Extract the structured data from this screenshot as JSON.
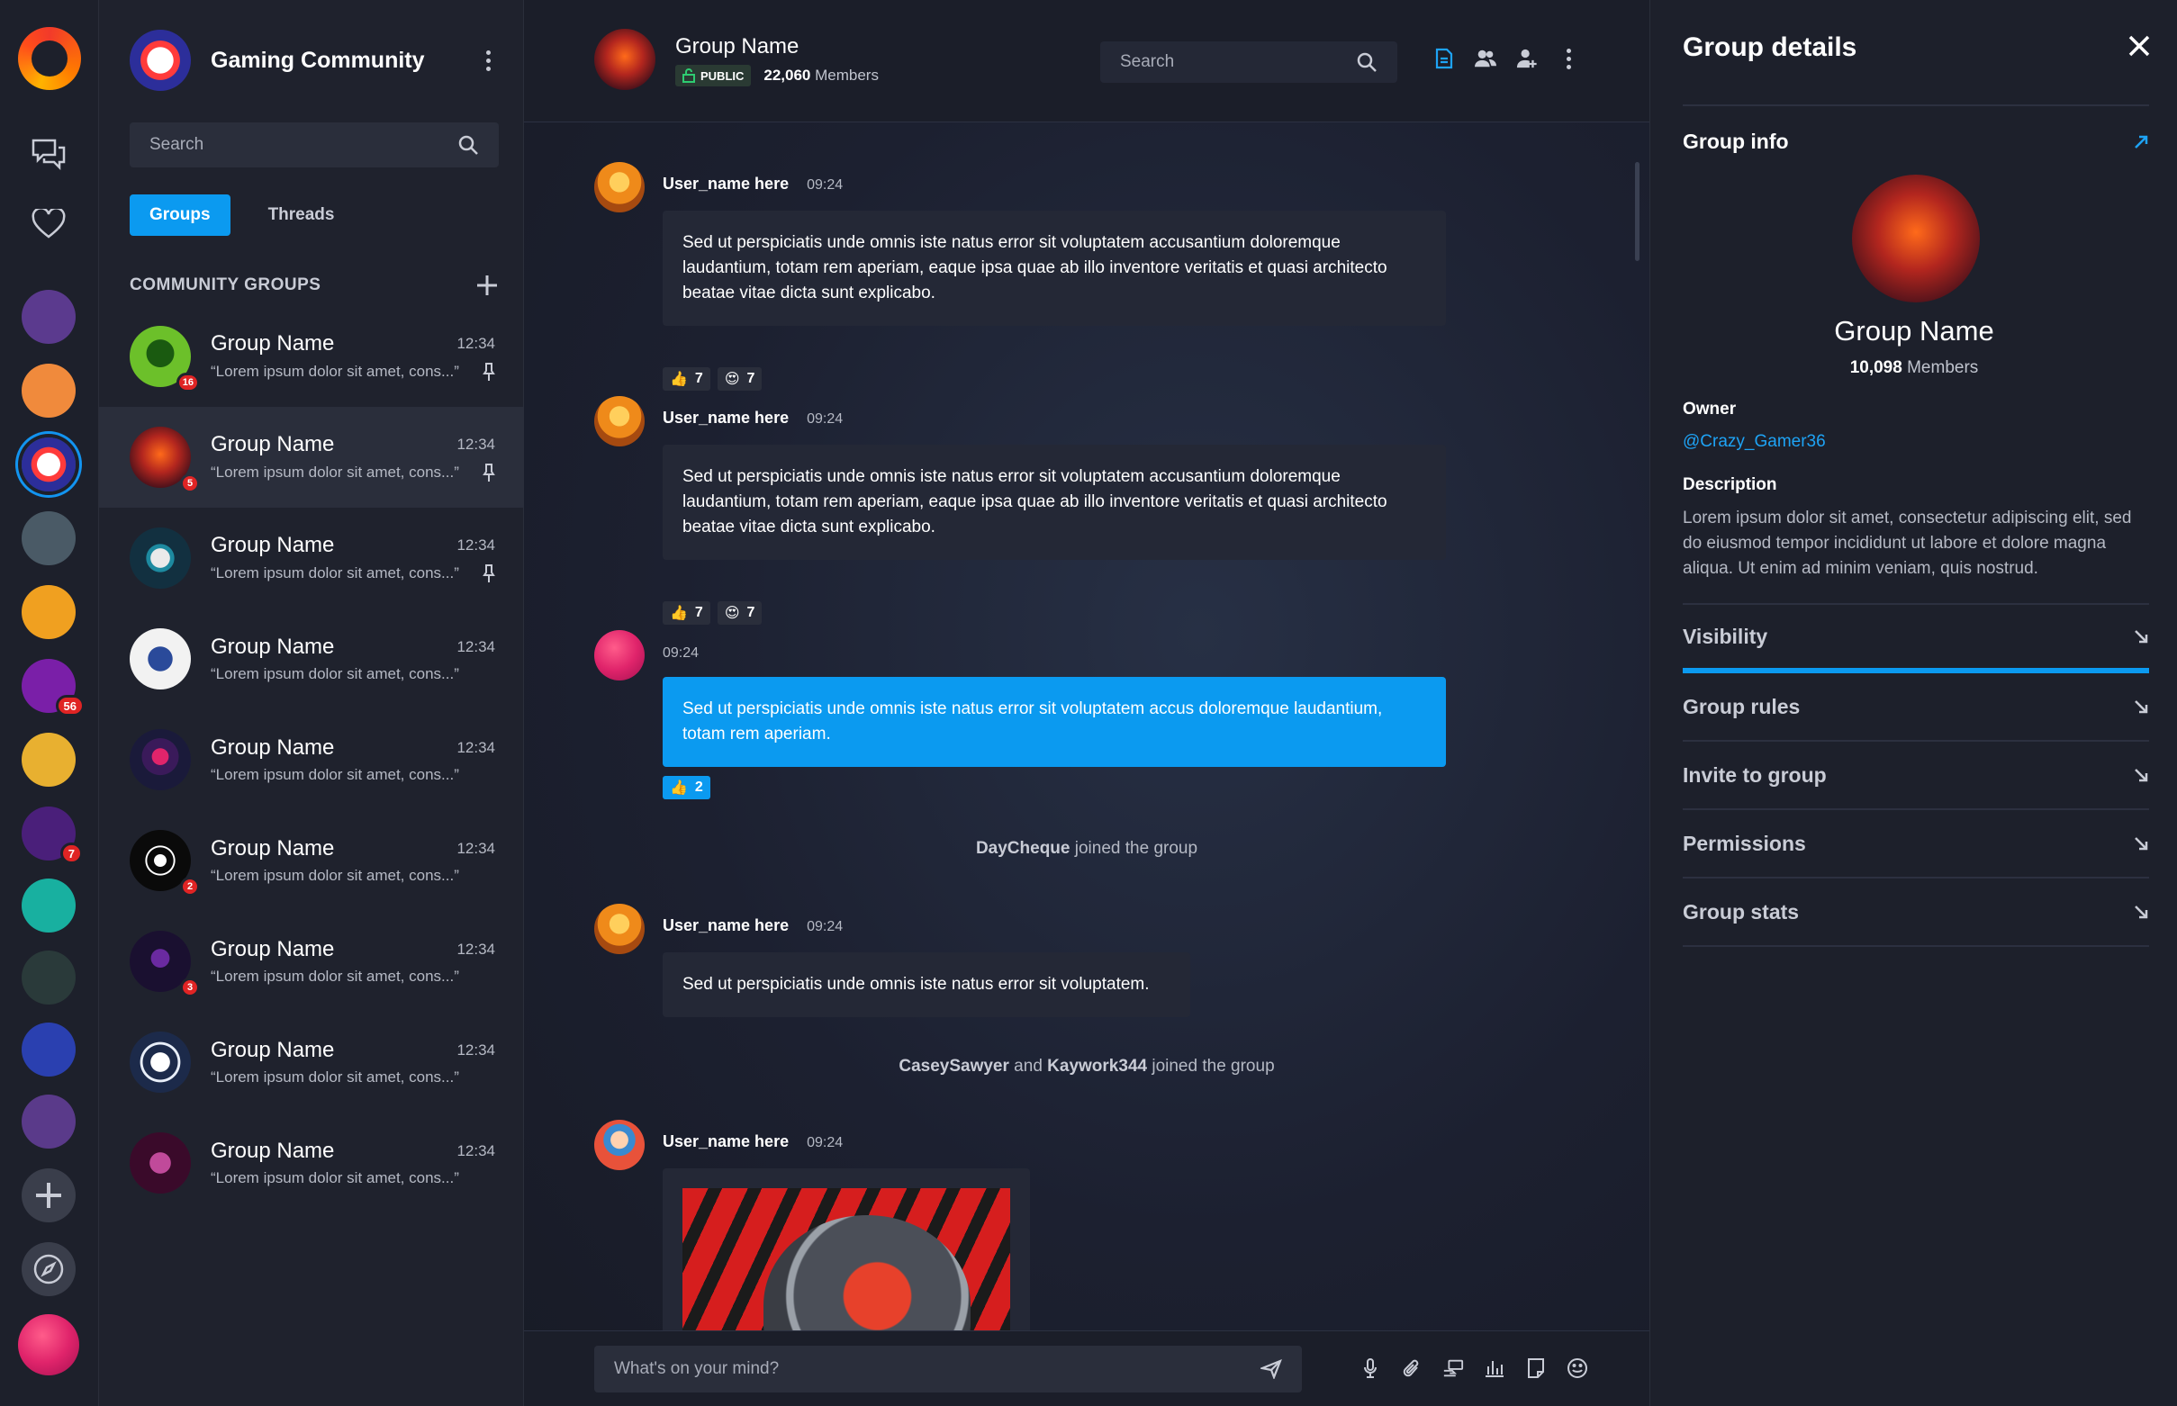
{
  "colors": {
    "accent": "#0b9af0",
    "background": "#171a24",
    "badge": "#e02424",
    "link": "#1ea3f5"
  },
  "rail": {
    "icons": [
      "logo",
      "chat-bubbles-icon",
      "heart-icon",
      "plus-icon",
      "compass-icon"
    ],
    "avatars": [
      {
        "name": "community-1",
        "color": "#5b3a8e"
      },
      {
        "name": "community-2",
        "color": "#f08a3c"
      },
      {
        "name": "community-3",
        "color": "#2c2e9a",
        "active": true
      },
      {
        "name": "community-4",
        "color": "#4a5a66"
      },
      {
        "name": "community-5",
        "color": "#f0a020"
      },
      {
        "name": "community-6",
        "color": "#7a1fa8",
        "badge": "56"
      },
      {
        "name": "community-7",
        "color": "#e8b030"
      },
      {
        "name": "community-8",
        "color": "#4a1f7a",
        "badge": "7"
      },
      {
        "name": "community-9",
        "color": "#18b0a0"
      },
      {
        "name": "community-10",
        "color": "#2a3a3a"
      },
      {
        "name": "community-11",
        "color": "#2a40b0"
      },
      {
        "name": "community-12",
        "color": "#5a3a8a"
      }
    ]
  },
  "panel": {
    "community_title": "Gaming Community",
    "search_placeholder": "Search",
    "tabs": [
      "Groups",
      "Threads"
    ],
    "section_label": "COMMUNITY GROUPS",
    "groups": [
      {
        "name": "Group Name",
        "time": "12:34",
        "preview": "“Lorem ipsum dolor sit amet, cons...”",
        "badge": "16",
        "pinned": true,
        "color": "#6cc02a"
      },
      {
        "name": "Group Name",
        "time": "12:34",
        "preview": "“Lorem ipsum dolor sit amet, cons...”",
        "badge": "5",
        "pinned": true,
        "color": "#b3261e",
        "active": true
      },
      {
        "name": "Group Name",
        "time": "12:34",
        "preview": "“Lorem ipsum dolor sit amet, cons...”",
        "badge": "",
        "pinned": true,
        "color": "#123040"
      },
      {
        "name": "Group Name",
        "time": "12:34",
        "preview": "“Lorem ipsum dolor sit amet, cons...”",
        "badge": "",
        "pinned": false,
        "color": "#f2f2f2"
      },
      {
        "name": "Group Name",
        "time": "12:34",
        "preview": "“Lorem ipsum dolor sit amet, cons...”",
        "badge": "",
        "pinned": false,
        "color": "#1a1a3a"
      },
      {
        "name": "Group Name",
        "time": "12:34",
        "preview": "“Lorem ipsum dolor sit amet, cons...”",
        "badge": "2",
        "pinned": false,
        "color": "#0a0a0a"
      },
      {
        "name": "Group Name",
        "time": "12:34",
        "preview": "“Lorem ipsum dolor sit amet, cons...”",
        "badge": "3",
        "pinned": false,
        "color": "#1a1030"
      },
      {
        "name": "Group Name",
        "time": "12:34",
        "preview": "“Lorem ipsum dolor sit amet, cons...”",
        "badge": "",
        "pinned": false,
        "color": "#1c2a4a"
      },
      {
        "name": "Group Name",
        "time": "12:34",
        "preview": "“Lorem ipsum dolor sit amet, cons...”",
        "badge": "",
        "pinned": false,
        "color": "#3a0a2a"
      }
    ]
  },
  "chat": {
    "group_name": "Group Name",
    "visibility": "PUBLIC",
    "members_count": "22,060",
    "members_label": "Members",
    "search_placeholder": "Search",
    "messages": [
      {
        "user": "User_name here",
        "time": "09:24",
        "text": "Sed ut perspiciatis unde omnis iste natus error sit voluptatem accusantium doloremque laudantium, totam rem aperiam, eaque ipsa quae ab illo inventore veritatis et quasi architecto beatae vitae dicta sunt explicabo.",
        "reactions": [
          {
            "emoji": "👍",
            "count": "7"
          },
          {
            "emoji": "😍",
            "count": "7"
          }
        ]
      },
      {
        "user": "User_name here",
        "time": "09:24",
        "text": "Sed ut perspiciatis unde omnis iste natus error sit voluptatem accusantium doloremque laudantium, totam rem aperiam, eaque ipsa quae ab illo inventore veritatis et quasi architecto beatae vitae dicta sunt explicabo.",
        "reactions": [
          {
            "emoji": "👍",
            "count": "7"
          },
          {
            "emoji": "😍",
            "count": "7"
          }
        ]
      },
      {
        "user": "",
        "time": "09:24",
        "text": "Sed ut perspiciatis unde omnis iste natus error sit voluptatem accus doloremque laudantium, totam rem aperiam.",
        "reactions": [
          {
            "emoji": "👍",
            "count": "2"
          }
        ]
      },
      {
        "user": "User_name here",
        "time": "09:24",
        "text": "Sed ut perspiciatis unde omnis iste natus error sit voluptatem."
      },
      {
        "user": "User_name here",
        "time": "09:24"
      }
    ],
    "system": [
      {
        "bold1": "DayCheque",
        "rest": " joined the group"
      },
      {
        "bold1": "CaseySawyer",
        "mid": " and ",
        "bold2": "Kaywork344",
        "rest": " joined the group"
      }
    ],
    "composer_placeholder": "What's on your mind?"
  },
  "details": {
    "title": "Group details",
    "group_info_label": "Group info",
    "group_name": "Group Name",
    "members_count": "10,098",
    "members_label": "Members",
    "owner_label": "Owner",
    "owner_value": "@Crazy_Gamer36",
    "description_label": "Description",
    "description_value": "Lorem ipsum dolor sit amet, consectetur adipiscing elit, sed do eiusmod tempor incididunt ut labore et dolore magna aliqua. Ut enim ad minim veniam, quis nostrud.",
    "sections": [
      "Visibility",
      "Group rules",
      "Invite to group",
      "Permissions",
      "Group stats"
    ]
  }
}
